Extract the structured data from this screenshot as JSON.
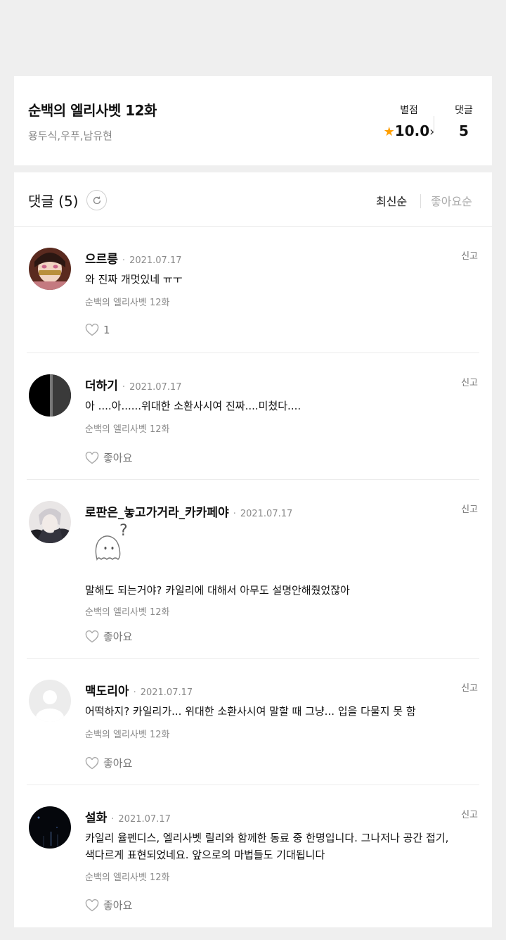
{
  "header": {
    "title": "순백의 엘리사벳 12화",
    "authors": "용두식,우푸,남유현",
    "rating_label": "별점",
    "rating_value": "10.0",
    "comments_label": "댓글",
    "comments_value": "5"
  },
  "list": {
    "title": "댓글 (5)",
    "sort_latest": "최신순",
    "sort_like": "좋아요순"
  },
  "comments": [
    {
      "nick": "으르릉",
      "date": "2021.07.17",
      "body": "와 진짜 개멋있네 ㅠㅜ",
      "episode": "순백의 엘리사벳 12화",
      "like": "1",
      "report": "신고"
    },
    {
      "nick": "더하기",
      "date": "2021.07.17",
      "body": "아 ....아......위대한 소환사시여 진짜....미쳤다....",
      "episode": "순백의 엘리사벳 12화",
      "like": "좋아요",
      "report": "신고"
    },
    {
      "nick": "로판은_놓고가거라_카카페야",
      "date": "2021.07.17",
      "body": "말해도 되는거야? 카일리에 대해서 아무도 설명안해줬었잖아",
      "episode": "순백의 엘리사벳 12화",
      "like": "좋아요",
      "report": "신고",
      "sticker": "?"
    },
    {
      "nick": "맥도리아",
      "date": "2021.07.17",
      "body": "어떡하지? 카일리가... 위대한 소환사시여 말할 때 그냥... 입을 다물지 못 함",
      "episode": "순백의 엘리사벳 12화",
      "like": "좋아요",
      "report": "신고"
    },
    {
      "nick": "설화",
      "date": "2021.07.17",
      "body": "카일리 율펜디스, 엘리사벳 릴리와 함께한 동료 중 한명입니다. 그나저나 공간 접기, 색다르게 표현되었네요. 앞으로의 마법들도 기대됩니다",
      "episode": "순백의 엘리사벳 12화",
      "like": "좋아요",
      "report": "신고"
    }
  ]
}
